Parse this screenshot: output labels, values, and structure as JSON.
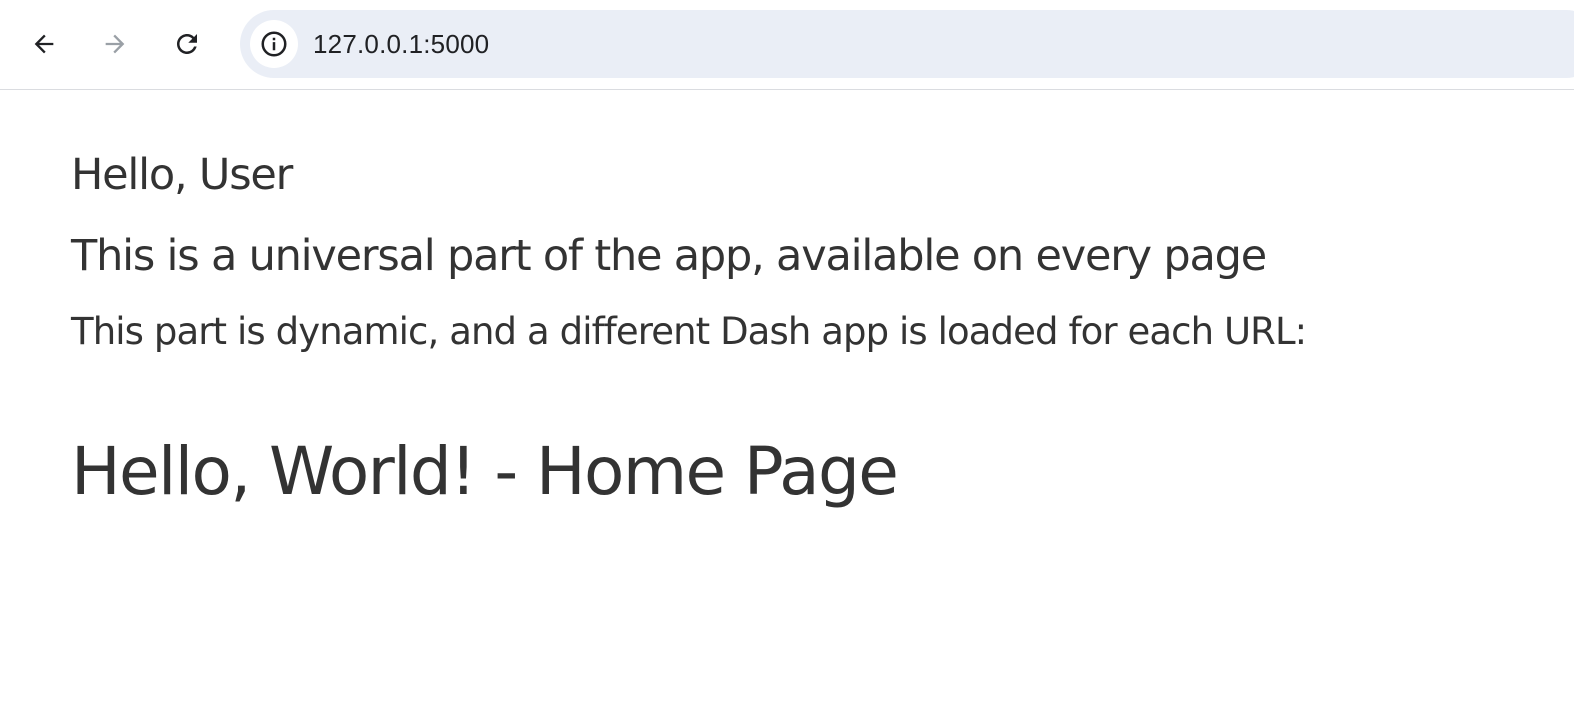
{
  "browser": {
    "url": "127.0.0.1:5000",
    "icons": {
      "back": "back-arrow-icon",
      "forward": "forward-arrow-icon",
      "reload": "reload-icon",
      "site_info": "info-icon"
    },
    "colors": {
      "omnibox_bg": "#eaeef6",
      "icon_active": "#202124",
      "icon_disabled": "#9aa0a6"
    }
  },
  "main": {
    "greeting": "Hello, User",
    "universal_text": "This is a universal part of the app, available on every page",
    "dynamic_text": "This part is dynamic, and a different Dash app is loaded for each URL:",
    "page_heading": "Hello, World! - Home Page",
    "text_color": "#333333"
  }
}
